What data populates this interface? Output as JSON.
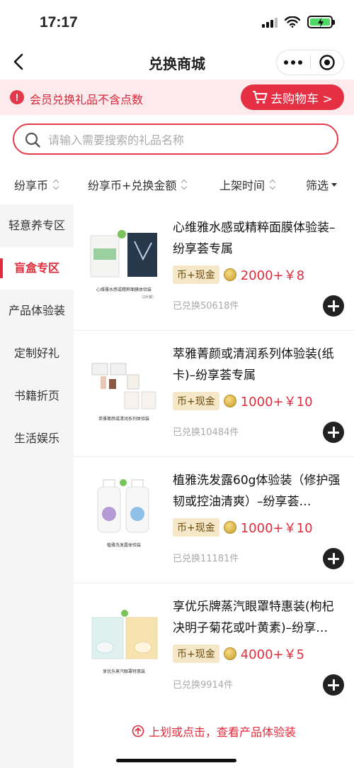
{
  "status": {
    "time": "17:17"
  },
  "nav": {
    "title": "兑换商城"
  },
  "notice": {
    "text": "会员兑换礼品不含点数",
    "cart_label": "去购物车 >"
  },
  "search": {
    "placeholder": "请输入需要搜索的礼品名称"
  },
  "sort": [
    "纷享币",
    "纷享币+兑换金额",
    "上架时间",
    "筛选"
  ],
  "sidebar": {
    "items": [
      {
        "label": "轻意养专区",
        "active": false
      },
      {
        "label": "盲盒专区",
        "active": true
      },
      {
        "label": "产品体验装",
        "active": false
      },
      {
        "label": "定制好礼",
        "active": false
      },
      {
        "label": "书籍折页",
        "active": false
      },
      {
        "label": "生活娱乐",
        "active": false
      }
    ]
  },
  "products": [
    {
      "title": "心维雅水感或精粹面膜体验装–纷享荟专属",
      "tag": "币+现金",
      "price": "2000+￥8",
      "redeemed": "已兑换50618件",
      "image_caption": "心维雅水感或精粹面膜体验装",
      "image_note": "（2片装）"
    },
    {
      "title": "萃雅菁颜或清润系列体验装(纸卡)–纷享荟专属",
      "tag": "币+现金",
      "price": "1000+￥10",
      "redeemed": "已兑换10484件",
      "image_caption": "萃雅菁颜或清润系列体验装"
    },
    {
      "title": "植雅洗发露60g体验装（修护强韧或控油清爽）–纷享荟…",
      "tag": "币+现金",
      "price": "1000+￥10",
      "redeemed": "已兑换11181件",
      "image_caption": "植雅洗发露体验装"
    },
    {
      "title": "享优乐牌蒸汽眼罩特惠装(枸杞决明子菊花或叶黄素)–纷享…",
      "tag": "币+现金",
      "price": "4000+￥5",
      "redeemed": "已兑换9914件",
      "image_caption": "享优乐蒸汽眼罩特惠装"
    }
  ],
  "footer": {
    "hint": "上划或点击，查看产品体验装"
  },
  "colors": {
    "brand_red": "#e52f43",
    "notice_bg": "#fdeaec",
    "tag_bg": "#f5e8c8"
  }
}
